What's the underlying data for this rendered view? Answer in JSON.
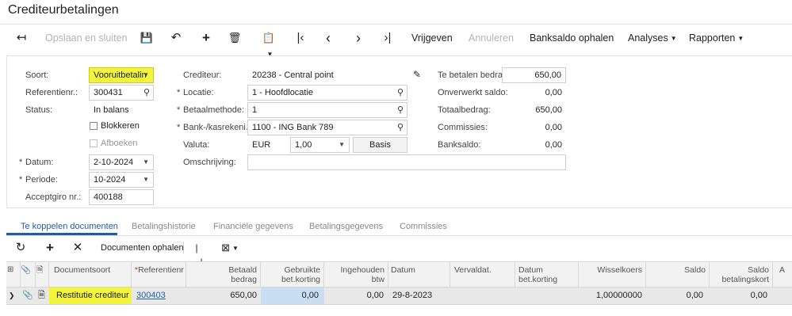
{
  "page": {
    "title": "Crediteurbetalingen"
  },
  "toolbar": {
    "save_close": "Opslaan en sluiten",
    "release": "Vrijgeven",
    "cancel": "Annuleren",
    "bank_balance": "Banksaldo ophalen",
    "analyses": "Analyses",
    "reports": "Rapporten"
  },
  "form": {
    "soort_label": "Soort:",
    "soort_value": "Vooruitbetalin",
    "ref_label": "Referentienr.:",
    "ref_value": "300431",
    "status_label": "Status:",
    "status_value": "In balans",
    "block_label": "Blokkeren",
    "writeoff_label": "Afboeken",
    "date_label": "Datum:",
    "date_value": "2-10-2024",
    "period_label": "Periode:",
    "period_value": "10-2024",
    "giro_label": "Acceptgiro nr.:",
    "giro_value": "400188",
    "creditor_label": "Crediteur:",
    "creditor_value": "20238 - Central point",
    "location_label": "Locatie:",
    "location_value": "1 - Hoofdlocatie",
    "method_label": "Betaalmethode:",
    "method_value": "1",
    "bank_label": "Bank-/kasrekeni...",
    "bank_value": "1100 - ING Bank 789",
    "currency_label": "Valuta:",
    "currency_value": "EUR",
    "rate_value": "1,00",
    "basis_label": "Basis",
    "desc_label": "Omschrijving:",
    "desc_value": "",
    "pay_amount_label": "Te betalen bedrag:",
    "pay_amount_value": "650,00",
    "unprocessed_label": "Onverwerkt saldo:",
    "unprocessed_value": "0,00",
    "total_label": "Totaalbedrag:",
    "total_value": "650,00",
    "commission_label": "Commissies:",
    "commission_value": "0,00",
    "bank_balance_label": "Banksaldo:",
    "bank_balance_value": "0,00"
  },
  "tabs": [
    {
      "label": "Te koppelen documenten"
    },
    {
      "label": "Betalingshistorie"
    },
    {
      "label": "Financiële gegevens"
    },
    {
      "label": "Betalingsgegevens"
    },
    {
      "label": "Commissies"
    }
  ],
  "grid_toolbar": {
    "fetch_docs": "Documenten ophalen"
  },
  "grid": {
    "headers": {
      "doc_type": "Documentsoort",
      "ref": "Referentienr",
      "paid": "Betaald bedrag",
      "used_discount": "Gebruikte bet.korting",
      "withheld_vat": "Ingehouden btw",
      "date": "Datum",
      "due_date": "Vervaldat.",
      "disc_date": "Datum bet.korting",
      "exchange_rate": "Wisselkoers",
      "balance": "Saldo",
      "disc_balance": "Saldo betalingskort",
      "more": "A"
    },
    "rows": [
      {
        "doc_type": "Restitutie crediteur",
        "ref": "300403",
        "paid": "650,00",
        "used_discount": "0,00",
        "withheld_vat": "0,00",
        "date": "29-8-2023",
        "due_date": "",
        "disc_date": "",
        "exchange_rate": "1,00000000",
        "balance": "0,00",
        "disc_balance": "0,00"
      }
    ]
  },
  "colors": {
    "accent": "#1e5f9e",
    "highlight": "#f2f53c",
    "cell_edit": "#c9def3"
  }
}
